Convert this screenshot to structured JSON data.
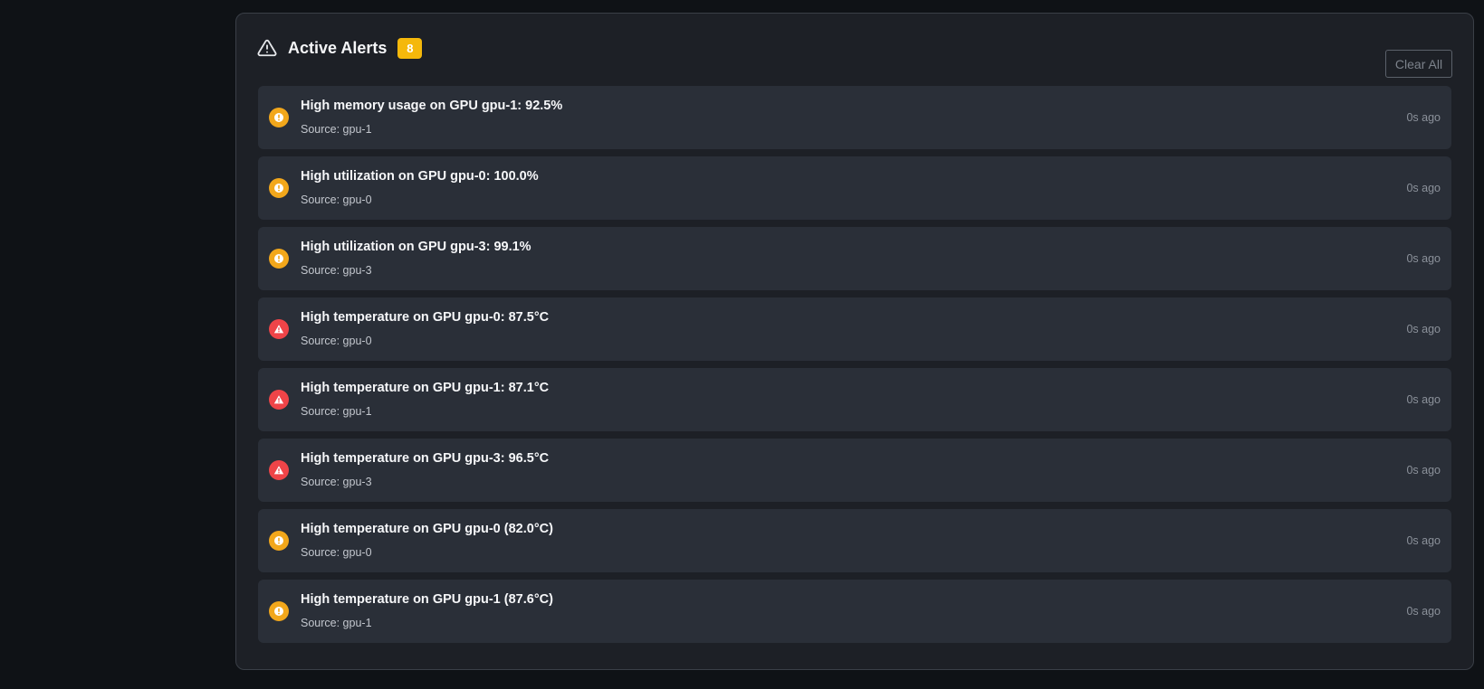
{
  "header": {
    "title": "Active Alerts",
    "count": "8",
    "clear_label": "Clear All"
  },
  "colors": {
    "warning": "#f2a71b",
    "critical": "#ef4448",
    "badge": "#f5b80b"
  },
  "alerts": [
    {
      "severity": "warning",
      "icon": "info-circle-icon",
      "message": "High memory usage on GPU gpu-1: 92.5%",
      "source": "Source: gpu-1",
      "time": "0s ago"
    },
    {
      "severity": "warning",
      "icon": "info-circle-icon",
      "message": "High utilization on GPU gpu-0: 100.0%",
      "source": "Source: gpu-0",
      "time": "0s ago"
    },
    {
      "severity": "warning",
      "icon": "info-circle-icon",
      "message": "High utilization on GPU gpu-3: 99.1%",
      "source": "Source: gpu-3",
      "time": "0s ago"
    },
    {
      "severity": "critical",
      "icon": "warning-triangle-icon",
      "message": "High temperature on GPU gpu-0: 87.5°C",
      "source": "Source: gpu-0",
      "time": "0s ago"
    },
    {
      "severity": "critical",
      "icon": "warning-triangle-icon",
      "message": "High temperature on GPU gpu-1: 87.1°C",
      "source": "Source: gpu-1",
      "time": "0s ago"
    },
    {
      "severity": "critical",
      "icon": "warning-triangle-icon",
      "message": "High temperature on GPU gpu-3: 96.5°C",
      "source": "Source: gpu-3",
      "time": "0s ago"
    },
    {
      "severity": "warning",
      "icon": "info-circle-icon",
      "message": "High temperature on GPU gpu-0 (82.0°C)",
      "source": "Source: gpu-0",
      "time": "0s ago"
    },
    {
      "severity": "warning",
      "icon": "info-circle-icon",
      "message": "High temperature on GPU gpu-1 (87.6°C)",
      "source": "Source: gpu-1",
      "time": "0s ago"
    }
  ]
}
